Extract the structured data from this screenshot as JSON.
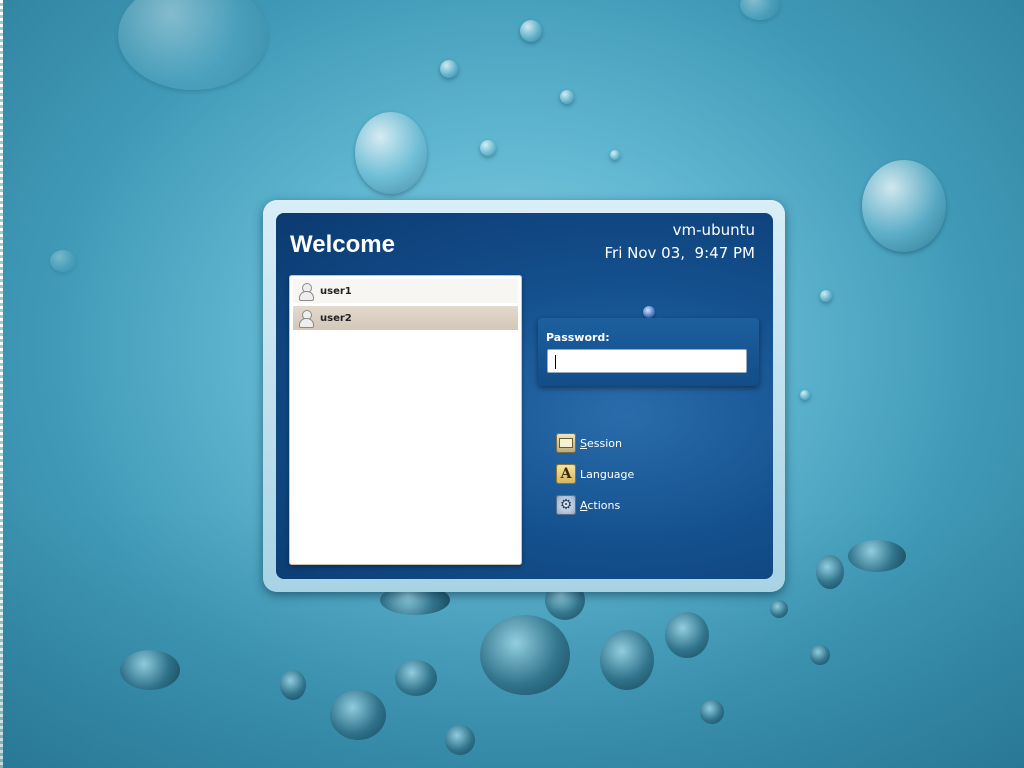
{
  "greeter": {
    "title": "Welcome",
    "hostname": "vm-ubuntu",
    "datetime": "Fri Nov 03,  9:47 PM"
  },
  "users": [
    {
      "name": "user1",
      "selected": false
    },
    {
      "name": "user2",
      "selected": true
    }
  ],
  "login": {
    "password_label": "Password:",
    "password_value": ""
  },
  "menu": {
    "session": "Session",
    "language": "Language",
    "actions": "Actions"
  },
  "icons": {
    "user": "user-avatar-icon",
    "session": "session-icon",
    "language": "language-icon",
    "actions": "actions-gear-icon"
  },
  "colors": {
    "panel": "#14508e",
    "frame": "#a7d3e4",
    "selected_row": "#d3c7b8"
  }
}
